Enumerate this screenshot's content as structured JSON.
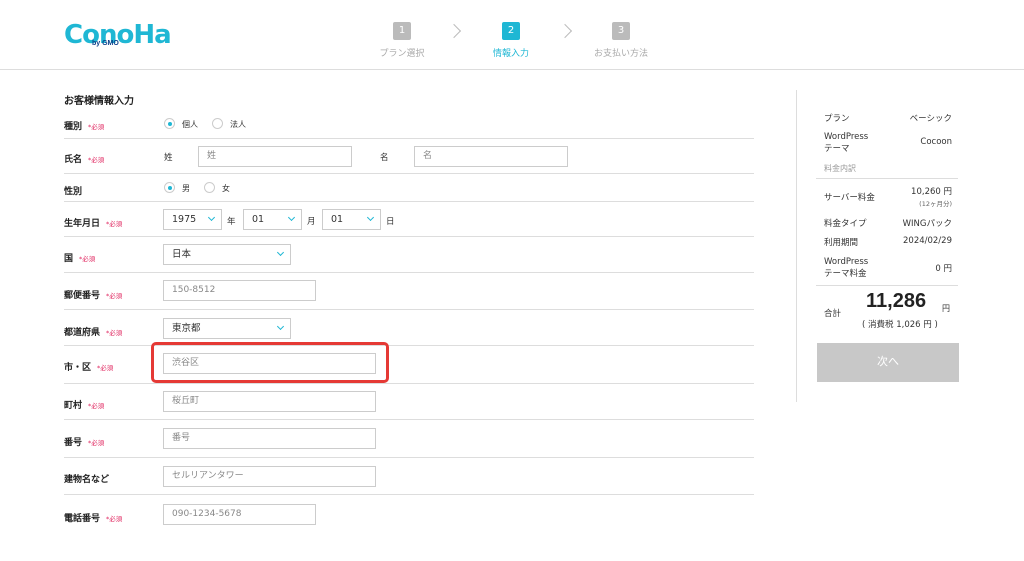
{
  "logo": {
    "main": "ConoHa",
    "sub": "by GMO"
  },
  "steps": [
    {
      "num": "1",
      "label": "プラン選択"
    },
    {
      "num": "2",
      "label": "情報入力"
    },
    {
      "num": "3",
      "label": "お支払い方法"
    }
  ],
  "form": {
    "title": "お客様情報入力",
    "required": "*必須",
    "type": {
      "label": "種別",
      "options": [
        "個人",
        "法人"
      ],
      "selected": "個人"
    },
    "name": {
      "label": "氏名",
      "last_label": "姓",
      "last_placeholder": "姓",
      "first_label": "名",
      "first_placeholder": "名"
    },
    "gender": {
      "label": "性別",
      "options": [
        "男",
        "女"
      ],
      "selected": "男"
    },
    "birth": {
      "label": "生年月日",
      "year": "1975",
      "year_unit": "年",
      "month": "01",
      "month_unit": "月",
      "day": "01",
      "day_unit": "日"
    },
    "country": {
      "label": "国",
      "value": "日本"
    },
    "postal": {
      "label": "郵便番号",
      "placeholder": "150-8512"
    },
    "prefecture": {
      "label": "都道府県",
      "value": "東京都"
    },
    "city": {
      "label": "市・区",
      "placeholder": "渋谷区"
    },
    "town": {
      "label": "町村",
      "placeholder": "桜丘町"
    },
    "number": {
      "label": "番号",
      "placeholder": "番号"
    },
    "building": {
      "label": "建物名など",
      "placeholder": "セルリアンタワー"
    },
    "phone": {
      "label": "電話番号",
      "placeholder": "090-1234-5678"
    }
  },
  "summary": {
    "plan_label": "プラン",
    "plan_value": "ベーシック",
    "theme_label": "WordPress\nテーマ",
    "theme_value": "Cocoon",
    "breakdown_label": "料金内訳",
    "server_label": "サーバー料金",
    "server_value": "10,260 円",
    "server_note": "(12ヶ月分)",
    "fee_type_label": "料金タイプ",
    "fee_type_value": "WINGパック",
    "period_label": "利用期間",
    "period_value": "2024/02/29",
    "theme_fee_label": "WordPress\nテーマ料金",
    "theme_fee_value": "0 円",
    "total_label": "合計",
    "total_value": "11,286",
    "total_unit": "円",
    "tax_note": "( 消費税 1,026 円 )",
    "next_button": "次へ"
  },
  "colors": {
    "accent": "#1fb7d4",
    "required": "#e0245e",
    "highlight": "#e53935",
    "button_disabled": "#c8c8c8"
  }
}
